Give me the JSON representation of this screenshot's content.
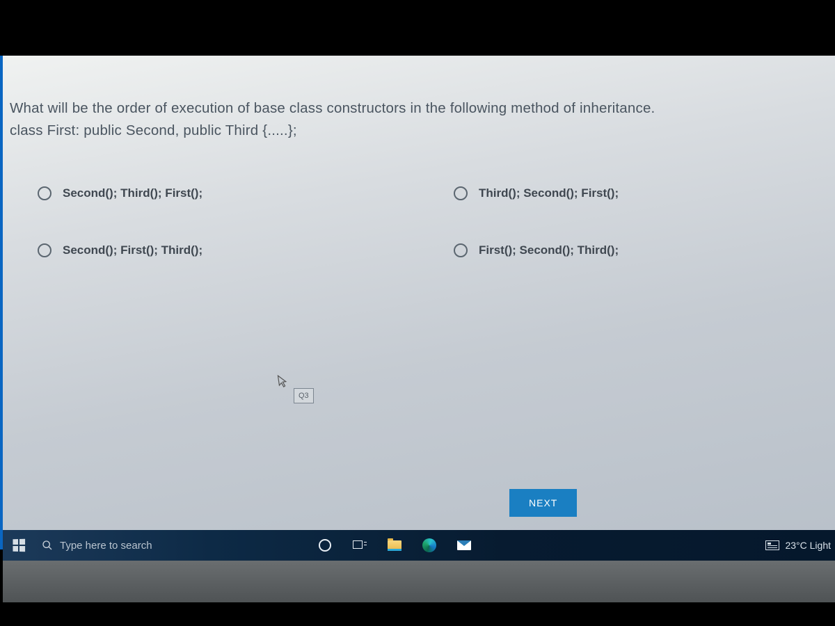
{
  "question": {
    "line1": "What will be the order of execution of base class constructors in the following method of inheritance.",
    "line2": "class First: public Second, public Third {.....};"
  },
  "options": {
    "a": "Second(); Third(); First();",
    "b": "Third(); Second(); First();",
    "c": "Second(); First(); Third();",
    "d": "First(); Second(); Third();"
  },
  "questionNumber": "Q3",
  "nextButton": "NEXT",
  "taskbar": {
    "searchPlaceholder": "Type here to search",
    "weather": "23°C  Light"
  }
}
